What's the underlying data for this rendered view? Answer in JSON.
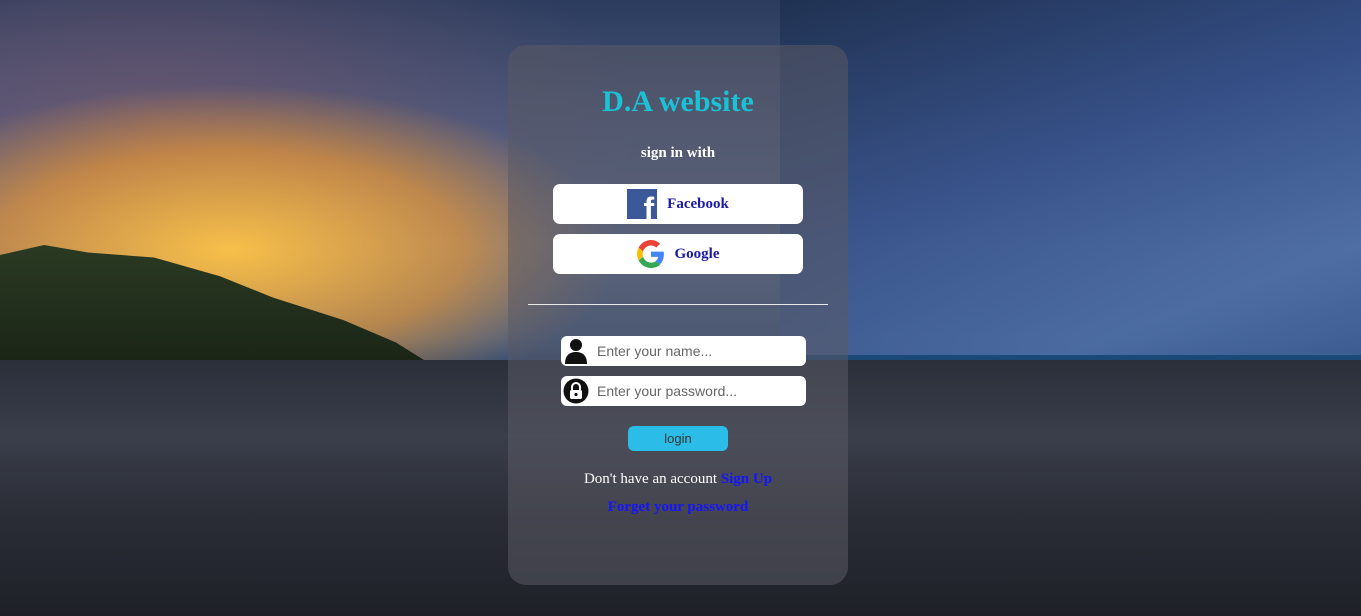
{
  "title": "D.A website",
  "subtitle": "sign in with",
  "social": {
    "facebook_label": "Facebook",
    "facebook_icon": "facebook-icon",
    "google_label": "Google",
    "google_icon": "google-icon"
  },
  "form": {
    "name_placeholder": "Enter your name...",
    "name_value": "",
    "name_icon": "user-icon",
    "password_placeholder": "Enter your password...",
    "password_value": "",
    "password_icon": "lock-icon",
    "login_label": "login"
  },
  "footer": {
    "no_account_text": "Don't have an account",
    "signup_label": "Sign Up",
    "forgot_label": "Forget your password"
  },
  "colors": {
    "title": "#1bc1d4",
    "login_button": "#2bbde8",
    "link": "#1414ff",
    "facebook": "#3b5998"
  }
}
